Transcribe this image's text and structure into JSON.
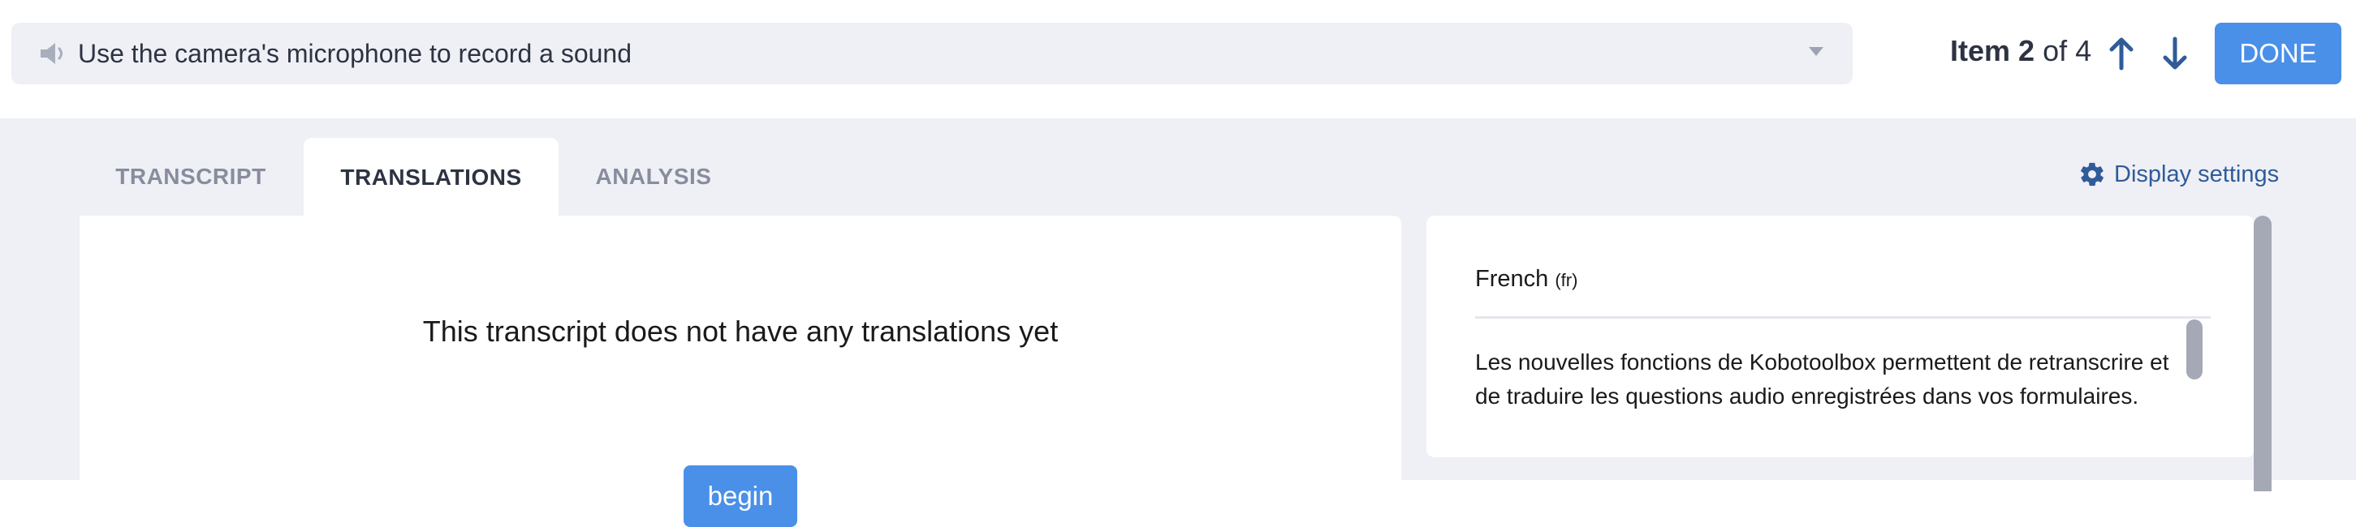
{
  "question_select": {
    "icon": "speaker-icon",
    "label": "Use the camera's microphone to record a sound"
  },
  "item_counter": {
    "prefix": "Item",
    "current": "2",
    "separator": "of",
    "total": "4"
  },
  "navigation": {
    "up_icon": "arrow-up-icon",
    "down_icon": "arrow-down-icon",
    "done_label": "DONE"
  },
  "tabs": [
    {
      "label": "TRANSCRIPT",
      "active": false
    },
    {
      "label": "TRANSLATIONS",
      "active": true
    },
    {
      "label": "ANALYSIS",
      "active": false
    }
  ],
  "display_settings": {
    "icon": "gear-icon",
    "label": "Display settings"
  },
  "translations_panel": {
    "empty_message": "This transcript does not have any translations yet",
    "begin_label": "begin"
  },
  "transcript_panel": {
    "language": "French",
    "language_code": "(fr)",
    "text": "Les nouvelles fonctions de Kobotoolbox permettent de retranscrire et de traduire les questions audio enregistrées dans vos formulaires."
  },
  "colors": {
    "accent": "#4a90e8",
    "link": "#2f5c99",
    "background": "#eff0f5",
    "text": "#2d3342",
    "muted": "#878d9e"
  }
}
